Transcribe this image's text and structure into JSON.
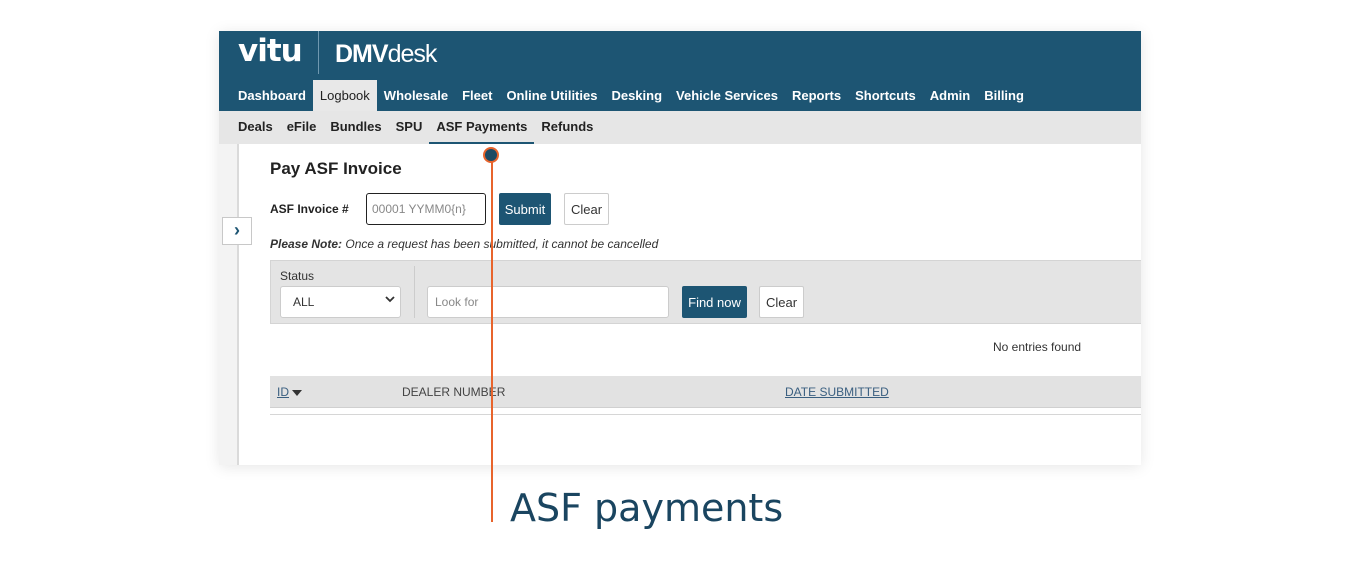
{
  "brand": {
    "logo_primary": "vitu",
    "logo_secondary_bold": "DMV",
    "logo_secondary_light": "desk"
  },
  "main_nav": {
    "items": [
      "Dashboard",
      "Logbook",
      "Wholesale",
      "Fleet",
      "Online Utilities",
      "Desking",
      "Vehicle Services",
      "Reports",
      "Shortcuts",
      "Admin",
      "Billing"
    ],
    "active": "Logbook"
  },
  "sub_nav": {
    "items": [
      "Deals",
      "eFile",
      "Bundles",
      "SPU",
      "ASF Payments",
      "Refunds"
    ],
    "active": "ASF Payments"
  },
  "sidebar": {
    "expand_icon": "chevron-right-icon",
    "expand_glyph": "›"
  },
  "page": {
    "title": "Pay ASF Invoice",
    "invoice_label": "ASF Invoice #",
    "invoice_placeholder": "00001 YYMM0{n}",
    "submit_label": "Submit",
    "clear_label": "Clear",
    "note_label": "Please Note:",
    "note_text": "Once a request has been submitted, it cannot be cancelled"
  },
  "filter": {
    "status_label": "Status",
    "status_value": "ALL",
    "search_placeholder": "Look for",
    "find_label": "Find now",
    "clear_label": "Clear"
  },
  "results": {
    "message": "No entries found",
    "columns": [
      "ID",
      "DEALER NUMBER",
      "DATE SUBMITTED"
    ]
  },
  "callout": {
    "text": "ASF payments"
  },
  "colors": {
    "brand": "#1d5573",
    "accent": "#e8642c",
    "subnav_bg": "#e6e6e6"
  }
}
